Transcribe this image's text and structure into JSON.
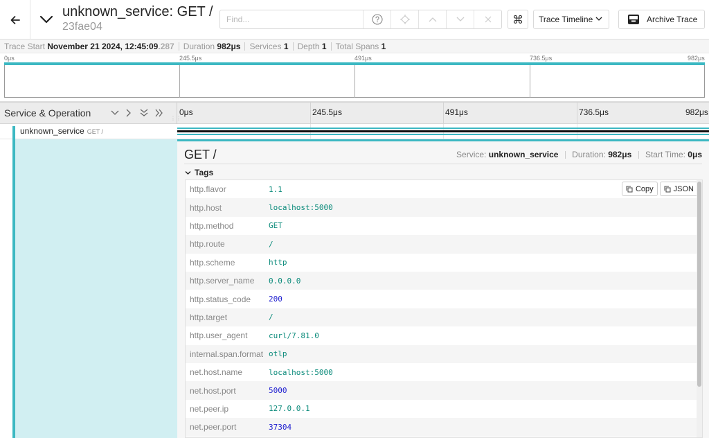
{
  "header": {
    "title": "unknown_service: GET /",
    "trace_id": "23fae04",
    "find_placeholder": "Find...",
    "view_select": "Trace Timeline",
    "archive_label": "Archive Trace",
    "kbd_symbol": "⌘"
  },
  "summary": {
    "trace_start_label": "Trace Start",
    "trace_start_value": "November 21 2024, 12:45:09",
    "trace_start_ms": ".287",
    "duration_label": "Duration",
    "duration_value": "982μs",
    "services_label": "Services",
    "services_value": "1",
    "depth_label": "Depth",
    "depth_value": "1",
    "total_spans_label": "Total Spans",
    "total_spans_value": "1"
  },
  "minimap": {
    "ticks": [
      "0μs",
      "245.5μs",
      "491μs",
      "736.5μs",
      "982μs"
    ]
  },
  "timeline": {
    "column_label": "Service & Operation",
    "ticks": [
      "0μs",
      "245.5μs",
      "491μs",
      "736.5μs",
      "982μs"
    ]
  },
  "span": {
    "service": "unknown_service",
    "operation": "GET /"
  },
  "detail": {
    "title": "GET /",
    "service_label": "Service:",
    "service_value": "unknown_service",
    "duration_label": "Duration:",
    "duration_value": "982μs",
    "start_label": "Start Time:",
    "start_value": "0μs",
    "tags_label": "Tags",
    "copy_label": "Copy",
    "json_label": "JSON",
    "tags": [
      {
        "key": "http.flavor",
        "value": "1.1",
        "type": "str"
      },
      {
        "key": "http.host",
        "value": "localhost:5000",
        "type": "str"
      },
      {
        "key": "http.method",
        "value": "GET",
        "type": "str"
      },
      {
        "key": "http.route",
        "value": "/",
        "type": "str"
      },
      {
        "key": "http.scheme",
        "value": "http",
        "type": "str"
      },
      {
        "key": "http.server_name",
        "value": "0.0.0.0",
        "type": "str"
      },
      {
        "key": "http.status_code",
        "value": "200",
        "type": "num"
      },
      {
        "key": "http.target",
        "value": "/",
        "type": "str"
      },
      {
        "key": "http.user_agent",
        "value": "curl/7.81.0",
        "type": "str"
      },
      {
        "key": "internal.span.format",
        "value": "otlp",
        "type": "str"
      },
      {
        "key": "net.host.name",
        "value": "localhost:5000",
        "type": "str"
      },
      {
        "key": "net.host.port",
        "value": "5000",
        "type": "num"
      },
      {
        "key": "net.peer.ip",
        "value": "127.0.0.1",
        "type": "str"
      },
      {
        "key": "net.peer.port",
        "value": "37304",
        "type": "num"
      }
    ]
  }
}
